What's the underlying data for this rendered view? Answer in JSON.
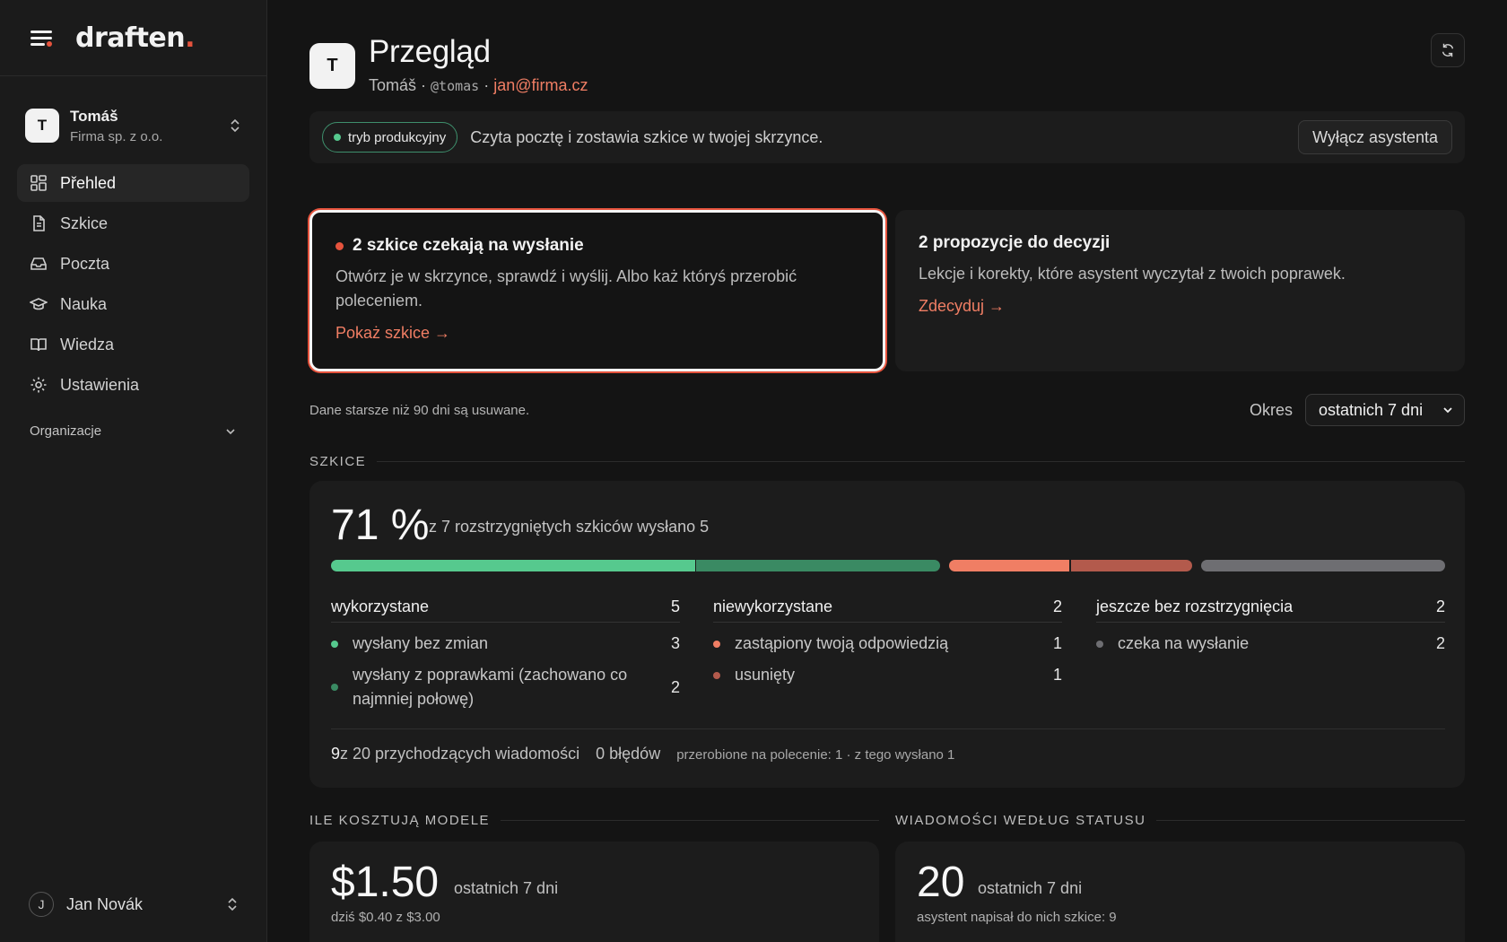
{
  "brand": {
    "name": "draften",
    "dot": "."
  },
  "account": {
    "initial": "T",
    "name": "Tomáš",
    "org": "Firma sp. z o.o."
  },
  "nav": {
    "items": [
      {
        "label": "Přehled",
        "icon": "dashboard-grid-icon"
      },
      {
        "label": "Szkice",
        "icon": "document-icon"
      },
      {
        "label": "Poczta",
        "icon": "inbox-icon"
      },
      {
        "label": "Nauka",
        "icon": "graduation-cap-icon"
      },
      {
        "label": "Wiedza",
        "icon": "book-open-icon"
      },
      {
        "label": "Ustawienia",
        "icon": "gear-icon"
      }
    ],
    "section": "Organizacje"
  },
  "user": {
    "initial": "J",
    "name": "Jan Novák"
  },
  "header": {
    "initial": "T",
    "title": "Przegląd",
    "name": "Tomáš",
    "sep": " · ",
    "handle": "@tomas",
    "email": "jan@firma.cz"
  },
  "banner": {
    "mode": "tryb produkcyjny",
    "text": "Czyta pocztę i zostawia szkice w twojej skrzynce.",
    "button": "Wyłącz asystenta"
  },
  "cards": {
    "pending": {
      "title": "2 szkice czekają na wysłanie",
      "text": "Otwórz je w skrzynce, sprawdź i wyślij. Albo każ któryś przerobić poleceniem.",
      "link": "Pokaż szkice →"
    },
    "decide": {
      "title": "2 propozycje do decyzji",
      "text": "Lekcje i korekty, które asystent wyczytał z twoich poprawek.",
      "link": "Zdecyduj →"
    }
  },
  "filter": {
    "note": "Dane starsze niż 90 dni są usuwane.",
    "label": "Okres",
    "value": "ostatnich 7 dni"
  },
  "drafts": {
    "section": "SZKICE",
    "percent": "71 %",
    "desc": "z 7 rozstrzygniętych szkiców wysłano 5",
    "bar_segments": [
      {
        "name": "wysłany bez zmian",
        "value": 3,
        "color": "#56c98e"
      },
      {
        "name": "wysłany z poprawkami",
        "value": 2,
        "color": "#3a8a63"
      },
      {
        "name": "zastąpiony twoją odpowiedzią",
        "value": 1,
        "color": "#f07e64"
      },
      {
        "name": "usunięty",
        "value": 1,
        "color": "#b35a4c"
      },
      {
        "name": "czeka na wysłanie",
        "value": 2,
        "color": "#6e6e72"
      }
    ],
    "columns": [
      {
        "title": "wykorzystane",
        "count": "5",
        "rows": [
          {
            "label": "wysłany bez zmian",
            "count": "3",
            "color": "#56c98e"
          },
          {
            "label": "wysłany z poprawkami (zachowano co najmniej połowę)",
            "count": "2",
            "color": "#3a8a63"
          }
        ]
      },
      {
        "title": "niewykorzystane",
        "count": "2",
        "rows": [
          {
            "label": "zastąpiony twoją odpowiedzią",
            "count": "1",
            "color": "#f07e64"
          },
          {
            "label": "usunięty",
            "count": "1",
            "color": "#b35a4c"
          }
        ]
      },
      {
        "title": "jeszcze bez rozstrzygnięcia",
        "count": "2",
        "rows": [
          {
            "label": "czeka na wysłanie",
            "count": "2",
            "color": "#6e6e72"
          }
        ]
      }
    ],
    "footer": {
      "incoming_count": "9",
      "incoming_text": " z 20 przychodzących wiadomości",
      "errors": "0 błędów",
      "reworked": "przerobione na polecenie: 1 · z tego wysłano 1"
    }
  },
  "costs": {
    "section": "ILE KOSZTUJĄ MODELE",
    "amount": "$1.50",
    "period": "ostatnich 7 dni",
    "sub": "dziś $0.40 z $3.00"
  },
  "status": {
    "section": "WIADOMOŚCI WEDŁUG STATUSU",
    "count": "20",
    "period": "ostatnich 7 dni",
    "sub": "asystent napisał do nich szkice: 9"
  },
  "colors": {
    "accent": "#e5533d",
    "link": "#f07e64",
    "green": "#56c98e"
  }
}
